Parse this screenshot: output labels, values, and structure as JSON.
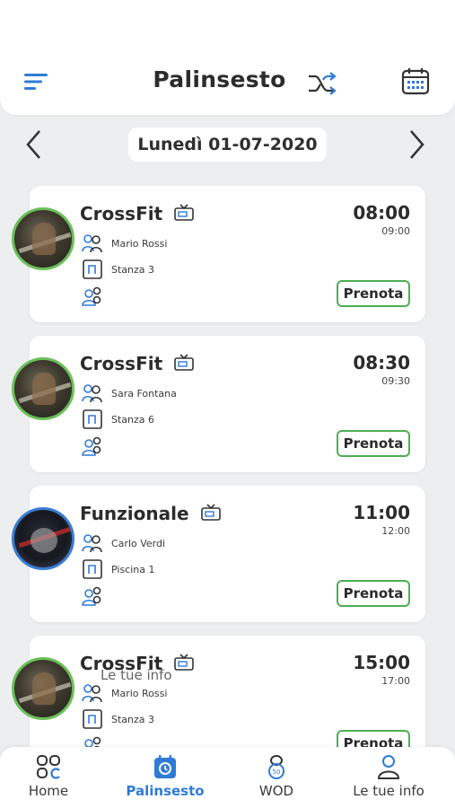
{
  "header": {
    "title": "Palinsesto"
  },
  "date_bar": {
    "date": "Lunedì 01-07-2020"
  },
  "cards": [
    {
      "name": "CrossFit",
      "trainer": "Mario Rossi",
      "room": "Stanza 3",
      "start": "08:00",
      "end": "09:00",
      "button": "Prenota"
    },
    {
      "name": "CrossFit",
      "trainer": "Sara Fontana",
      "room": "Stanza 6",
      "start": "08:30",
      "end": "09:30",
      "button": "Prenota"
    },
    {
      "name": "Funzionale",
      "trainer": "Carlo Verdi",
      "room": "Piscina 1",
      "start": "11:00",
      "end": "12:00",
      "button": "Prenota"
    },
    {
      "name": "CrossFit",
      "trainer": "Mario Rossi",
      "room": "Stanza 3",
      "start": "15:00",
      "end": "17:00",
      "button": "Prenota"
    }
  ],
  "overlay_label": "Le tue info",
  "nav": {
    "items": [
      {
        "label": "Home",
        "icon": "home-grid-icon"
      },
      {
        "label": "Palinsesto",
        "icon": "schedule-clock-icon",
        "active": true
      },
      {
        "label": "WOD",
        "icon": "wod-stopwatch-icon"
      },
      {
        "label": "Le tue info",
        "icon": "user-icon"
      }
    ]
  },
  "colors": {
    "accent_blue": "#2f7bd6",
    "accent_green": "#4caf50",
    "background": "#eceeef"
  }
}
